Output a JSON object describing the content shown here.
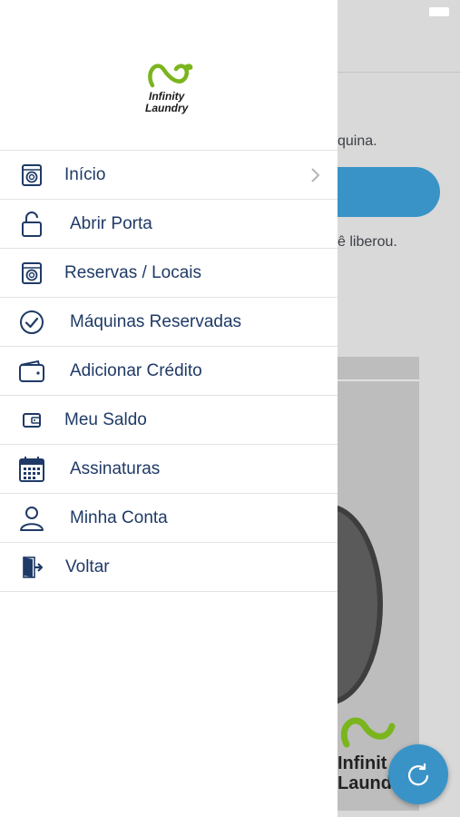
{
  "background": {
    "text_top": "quina.",
    "text_bottom": "ê liberou.",
    "logo_line1": "Infinit",
    "logo_line2": "Laund"
  },
  "drawer": {
    "logo_line1": "Infinity",
    "logo_line2": "Laundry",
    "items": [
      {
        "label": "Início",
        "icon": "washing-machine-icon"
      },
      {
        "label": "Abrir Porta",
        "icon": "unlock-icon"
      },
      {
        "label": "Reservas / Locais",
        "icon": "washing-machine-icon"
      },
      {
        "label": "Máquinas Reservadas",
        "icon": "check-circle-icon"
      },
      {
        "label": "Adicionar Crédito",
        "icon": "wallet-icon"
      },
      {
        "label": "Meu Saldo",
        "icon": "wallet-small-icon"
      },
      {
        "label": "Assinaturas",
        "icon": "calendar-icon"
      },
      {
        "label": "Minha Conta",
        "icon": "user-icon"
      },
      {
        "label": "Voltar",
        "icon": "exit-door-icon"
      }
    ]
  },
  "colors": {
    "menu_text": "#1f3a66",
    "accent_blue": "#3a93c7",
    "logo_green": "#7ab51d"
  }
}
